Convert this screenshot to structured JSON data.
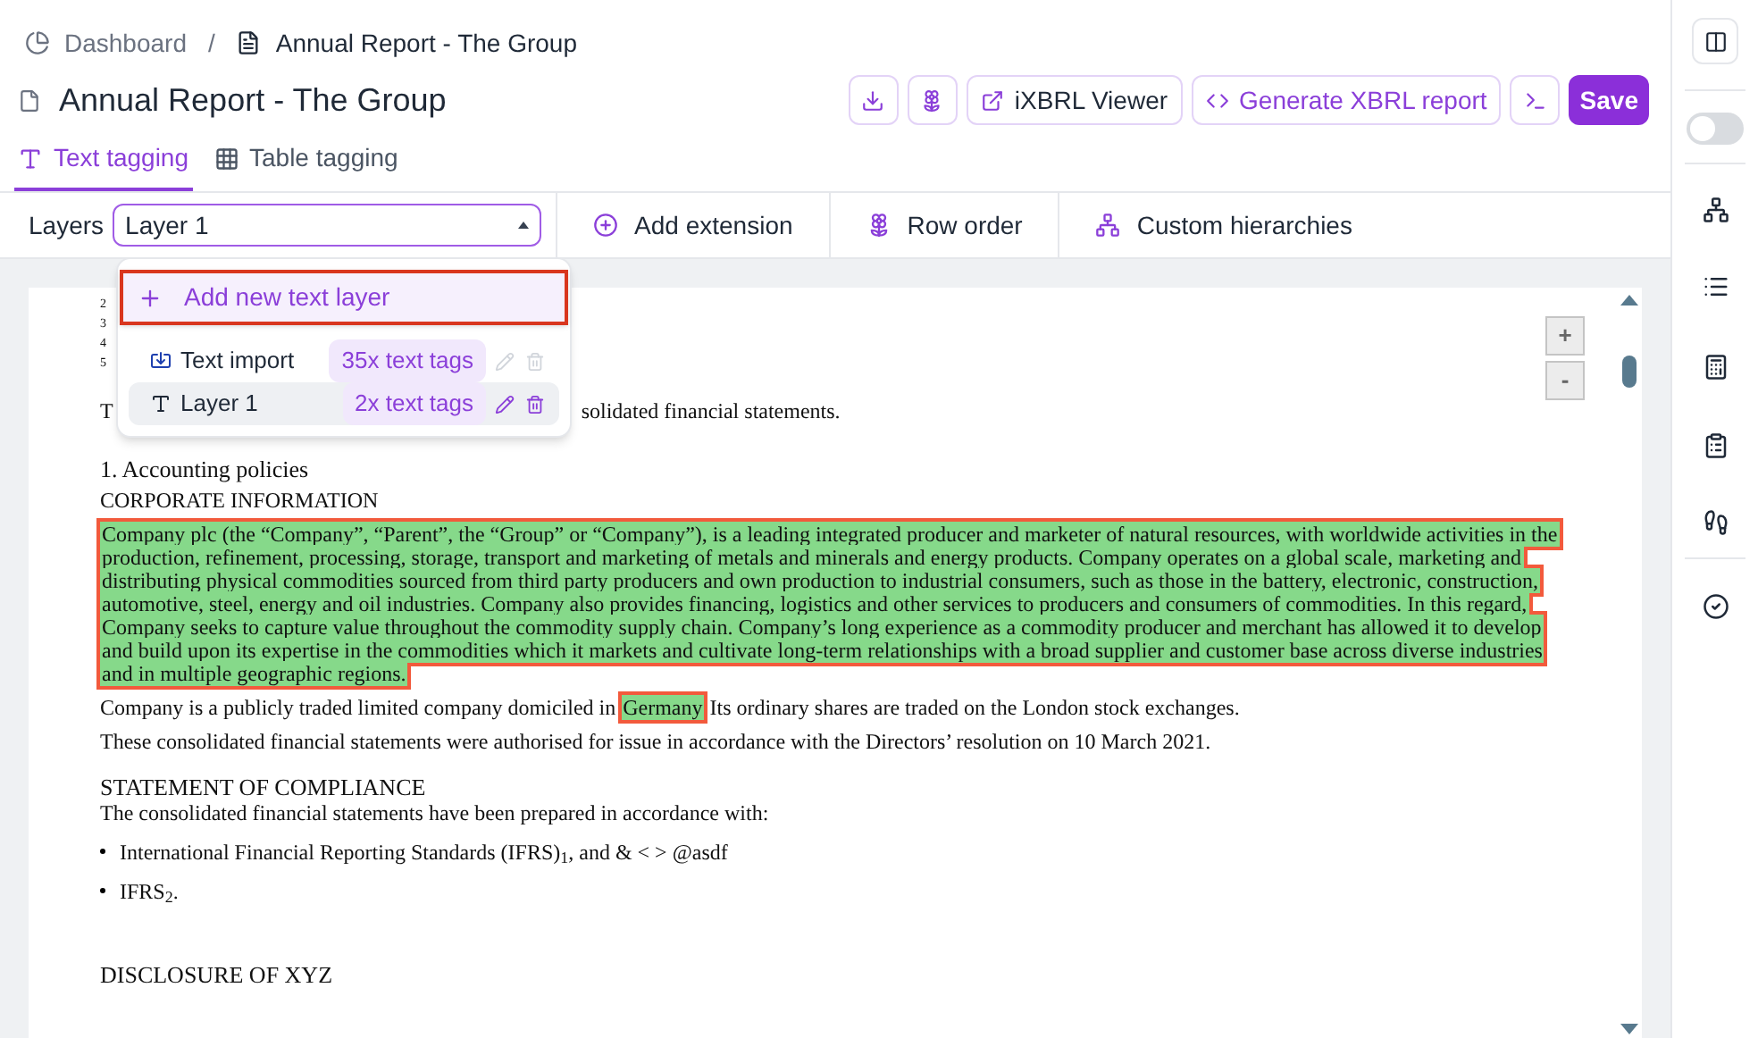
{
  "breadcrumb": [
    {
      "label": "Dashboard"
    },
    {
      "label": "Annual Report - The Group"
    }
  ],
  "breadcrumb_separator": "/",
  "title": "Annual Report - The Group",
  "actions": [
    {
      "label": "iXBRL Viewer",
      "kind": "outline"
    },
    {
      "label": "Generate XBRL report",
      "kind": "outline"
    },
    {
      "label": "Save",
      "kind": "primary"
    }
  ],
  "tabs": [
    {
      "label": "Text tagging",
      "selected": true
    },
    {
      "label": "Table tagging",
      "selected": false
    }
  ],
  "toolbar": {
    "layers_label": "Layers",
    "layer_select": {
      "value": "Layer 1",
      "expanded": true
    },
    "buttons": [
      {
        "label": "Add extension"
      },
      {
        "label": "Row order"
      },
      {
        "label": "Custom hierarchies"
      }
    ]
  },
  "layer_menu": {
    "add_item": {
      "label": "Add new text layer",
      "highlighted": true
    },
    "layers": [
      {
        "kind": "import",
        "name": "Text import",
        "badge": "35x text tags",
        "selected": false,
        "editable": false
      },
      {
        "kind": "text",
        "name": "Layer 1",
        "badge": "2x text tags",
        "selected": true,
        "editable": true
      }
    ]
  },
  "sidebar_toggle": {
    "on": false
  },
  "document": {
    "line_numbers": [
      "2",
      "3",
      "4",
      "5"
    ],
    "covered_line": {
      "start": "T",
      "end": "solidated financial statements."
    },
    "zoom": [
      "+",
      "-"
    ],
    "blocks": [
      {
        "kind": "heading",
        "text": "1. Accounting policies"
      },
      {
        "kind": "label",
        "text": "CORPORATE INFORMATION"
      },
      {
        "kind": "paragraph",
        "parts": [
          {
            "text": "Company plc (the “Company”, “Parent”, the “Group” or “Company”), is a leading integrated producer and marketer of natural resources, with worldwide activities in the production, refinement, processing, storage, transport and marketing of metals and minerals and energy products. Company operates on a global scale, marketing and distributing physical commodities sourced from third party producers and own production to industrial consumers, such as those in the battery, electronic, construction, automotive, steel, energy and oil industries. Company also provides financing, logistics and other services to producers and consumers of commodities. In this regard, Company seeks to capture value throughout the commodity supply chain. Company’s long experience as a commodity producer and merchant has allowed it to develop and build upon its expertise in the commodities which it markets and cultivate long-term relationships with a broad supplier and customer base across diverse industries and in multiple geographic regions.",
            "tagged": true
          }
        ]
      },
      {
        "kind": "paragraph",
        "parts": [
          {
            "text": "Company is a publicly traded limited company domiciled in",
            "tagged": false
          },
          {
            "text": "Germany",
            "tagged": true
          },
          {
            "text": "Its ordinary shares are traded on the London stock exchanges.",
            "tagged": false
          }
        ]
      },
      {
        "kind": "paragraph",
        "parts": [
          {
            "text": "These consolidated financial statements were authorised for issue in accordance with the Directors’ resolution on 10 March 2021.",
            "tagged": false
          }
        ]
      },
      {
        "kind": "heading",
        "text": "STATEMENT OF COMPLIANCE"
      },
      {
        "kind": "label",
        "text": "The consolidated financial statements have been prepared in accordance with:"
      },
      {
        "kind": "bullet",
        "text": "International Financial Reporting Standards (IFRS)$_{1}$, and & < > @asdf"
      },
      {
        "kind": "bullet",
        "text": "IFRS$_{2}$."
      },
      {
        "kind": "section",
        "text": "DISCLOSURE OF XYZ"
      }
    ]
  }
}
